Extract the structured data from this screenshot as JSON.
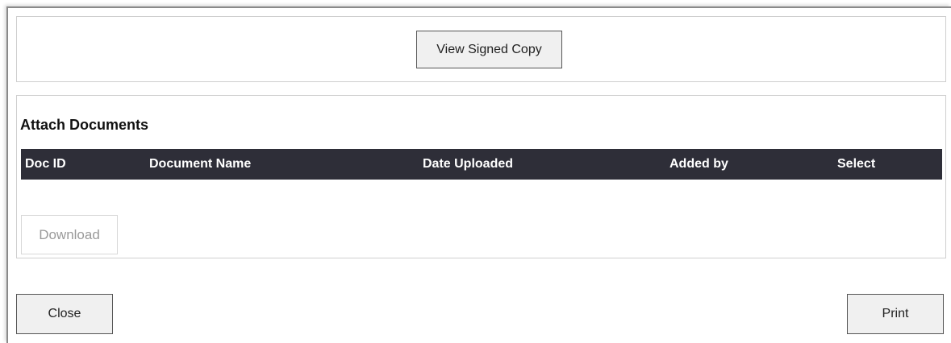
{
  "signed_section": {
    "view_signed_copy_label": "View Signed Copy"
  },
  "attach_section": {
    "title": "Attach Documents",
    "columns": [
      "Doc ID",
      "Document Name",
      "Date Uploaded",
      "Added by",
      "Select"
    ],
    "rows": [],
    "download_label": "Download"
  },
  "footer": {
    "close_label": "Close",
    "print_label": "Print"
  },
  "colors": {
    "table_header_bg": "#2e2e38",
    "button_bg": "#f0f0f0"
  }
}
